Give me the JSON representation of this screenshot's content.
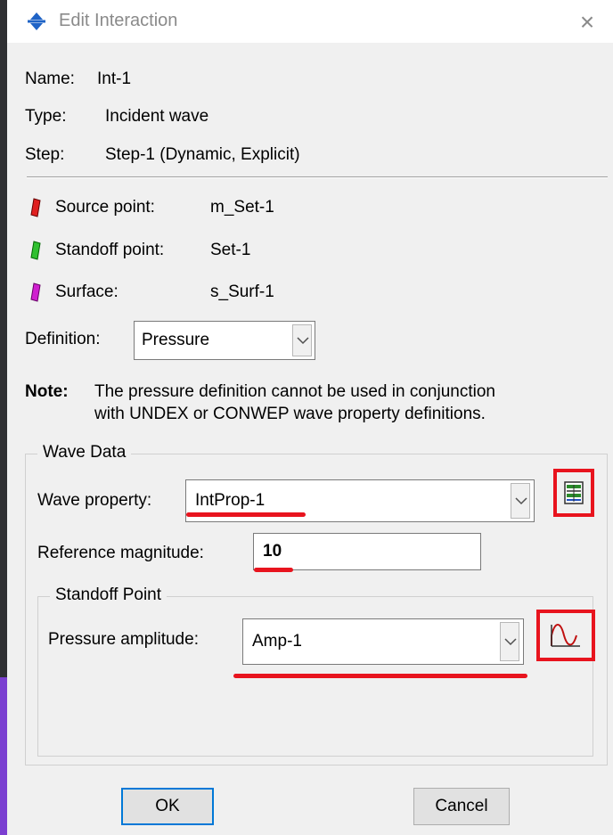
{
  "window": {
    "title": "Edit Interaction",
    "close_glyph": "×"
  },
  "info": {
    "name_label": "Name:",
    "name_value": "Int-1",
    "type_label": "Type:",
    "type_value": "Incident wave",
    "step_label": "Step:",
    "step_value": "Step-1 (Dynamic, Explicit)"
  },
  "regions": [
    {
      "label": "Source point:",
      "value": "m_Set-1",
      "color": "#e02020"
    },
    {
      "label": "Standoff point:",
      "value": "Set-1",
      "color": "#30c030"
    },
    {
      "label": "Surface:",
      "value": "s_Surf-1",
      "color": "#d020d0"
    }
  ],
  "definition": {
    "label": "Definition:",
    "value": "Pressure"
  },
  "note": {
    "label": "Note:",
    "line1": "The pressure definition cannot be used in conjunction",
    "line2": "with UNDEX or CONWEP wave property definitions."
  },
  "wave_data": {
    "title": "Wave Data",
    "wave_property_label": "Wave property:",
    "wave_property_value": "IntProp-1",
    "reference_magnitude_label": "Reference magnitude:",
    "reference_magnitude_value": "10"
  },
  "standoff_point": {
    "title": "Standoff Point",
    "pressure_amplitude_label": "Pressure amplitude:",
    "pressure_amplitude_value": "Amp-1"
  },
  "buttons": {
    "ok": "OK",
    "cancel": "Cancel"
  },
  "colors": {
    "highlight": "#e8141e",
    "dialog_bg": "#f0f0f0"
  }
}
